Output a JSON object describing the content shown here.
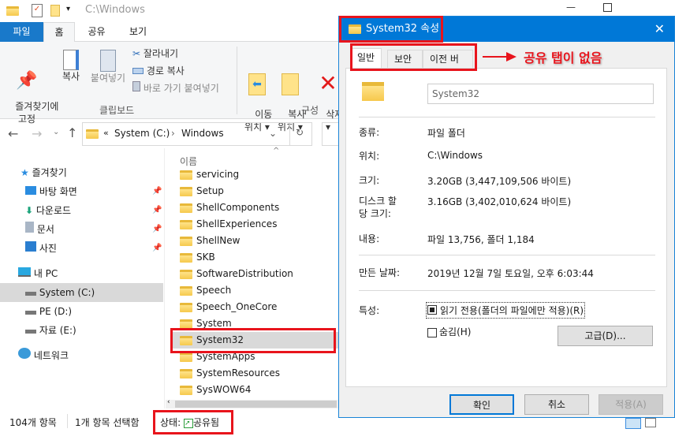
{
  "explorer": {
    "title": "C:\\Windows",
    "tabs": [
      "파일",
      "홈",
      "공유",
      "보기"
    ],
    "ribbon": {
      "pin": "즐겨찾기에\n고정",
      "copy": "복사",
      "paste": "붙여넣기",
      "cut": "잘라내기",
      "copy_path": "경로 복사",
      "paste_shortcut": "바로 가기 붙여넣기",
      "group_clipboard": "클립보드",
      "move_to": "이동\n위치 ▾",
      "copy_to": "복사\n위치 ▾",
      "delete": "삭제\n▾",
      "group_organize": "구성"
    },
    "address": {
      "prefix": "«",
      "drive": "System (C:)",
      "sep": "›",
      "folder": "Windows"
    },
    "nav": {
      "quick_access": "즐겨찾기",
      "items": [
        "바탕 화면",
        "다운로드",
        "문서",
        "사진"
      ],
      "this_pc": "내 PC",
      "drives": [
        "System (C:)",
        "PE (D:)",
        "자료 (E:)"
      ],
      "network": "네트워크"
    },
    "column_name": "이름",
    "files": [
      "servicing",
      "Setup",
      "ShellComponents",
      "ShellExperiences",
      "ShellNew",
      "SKB",
      "SoftwareDistribution",
      "Speech",
      "Speech_OneCore",
      "System",
      "System32",
      "SystemApps",
      "SystemResources",
      "SysWOW64"
    ],
    "selected_file": "System32",
    "status": {
      "count": "104개 항목",
      "selected": "1개 항목 선택함",
      "state_label": "상태:",
      "state_value": "공유됨"
    }
  },
  "dialog": {
    "title": "System32 속성",
    "tabs": [
      "일반",
      "보안",
      "이전 버전"
    ],
    "name_value": "System32",
    "rows": [
      {
        "label": "종류:",
        "value": "파일 폴더"
      },
      {
        "label": "위치:",
        "value": "C:\\Windows"
      },
      {
        "label": "크기:",
        "value": "3.20GB (3,447,109,506 바이트)"
      },
      {
        "label": "디스크 할\n당 크기:",
        "value": "3.16GB (3,402,010,624 바이트)"
      },
      {
        "label": "내용:",
        "value": "파일 13,756, 폴더 1,184"
      },
      {
        "label": "만든 날짜:",
        "value": "2019년 12월 7일 토요일, 오후 6:03:44"
      }
    ],
    "attributes_label": "특성:",
    "readonly": "읽기 전용(폴더의 파일에만 적용)(R)",
    "readonly_state": "indeterminate",
    "hidden": "숨김(H)",
    "hidden_checked": false,
    "advanced": "고급(D)...",
    "ok": "확인",
    "cancel": "취소",
    "apply": "적용(A)"
  },
  "annotation": {
    "text": "공유 탭이 없음",
    "color": "#e8141c"
  },
  "colors": {
    "accent": "#0078d7",
    "file_tab": "#1979ca"
  }
}
